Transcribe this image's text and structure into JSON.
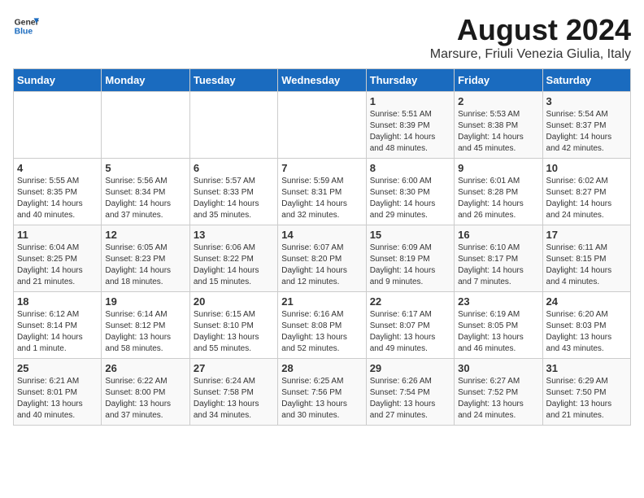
{
  "logo": {
    "text_general": "General",
    "text_blue": "Blue"
  },
  "title": "August 2024",
  "subtitle": "Marsure, Friuli Venezia Giulia, Italy",
  "headers": [
    "Sunday",
    "Monday",
    "Tuesday",
    "Wednesday",
    "Thursday",
    "Friday",
    "Saturday"
  ],
  "weeks": [
    [
      {
        "day": "",
        "info": ""
      },
      {
        "day": "",
        "info": ""
      },
      {
        "day": "",
        "info": ""
      },
      {
        "day": "",
        "info": ""
      },
      {
        "day": "1",
        "info": "Sunrise: 5:51 AM\nSunset: 8:39 PM\nDaylight: 14 hours\nand 48 minutes."
      },
      {
        "day": "2",
        "info": "Sunrise: 5:53 AM\nSunset: 8:38 PM\nDaylight: 14 hours\nand 45 minutes."
      },
      {
        "day": "3",
        "info": "Sunrise: 5:54 AM\nSunset: 8:37 PM\nDaylight: 14 hours\nand 42 minutes."
      }
    ],
    [
      {
        "day": "4",
        "info": "Sunrise: 5:55 AM\nSunset: 8:35 PM\nDaylight: 14 hours\nand 40 minutes."
      },
      {
        "day": "5",
        "info": "Sunrise: 5:56 AM\nSunset: 8:34 PM\nDaylight: 14 hours\nand 37 minutes."
      },
      {
        "day": "6",
        "info": "Sunrise: 5:57 AM\nSunset: 8:33 PM\nDaylight: 14 hours\nand 35 minutes."
      },
      {
        "day": "7",
        "info": "Sunrise: 5:59 AM\nSunset: 8:31 PM\nDaylight: 14 hours\nand 32 minutes."
      },
      {
        "day": "8",
        "info": "Sunrise: 6:00 AM\nSunset: 8:30 PM\nDaylight: 14 hours\nand 29 minutes."
      },
      {
        "day": "9",
        "info": "Sunrise: 6:01 AM\nSunset: 8:28 PM\nDaylight: 14 hours\nand 26 minutes."
      },
      {
        "day": "10",
        "info": "Sunrise: 6:02 AM\nSunset: 8:27 PM\nDaylight: 14 hours\nand 24 minutes."
      }
    ],
    [
      {
        "day": "11",
        "info": "Sunrise: 6:04 AM\nSunset: 8:25 PM\nDaylight: 14 hours\nand 21 minutes."
      },
      {
        "day": "12",
        "info": "Sunrise: 6:05 AM\nSunset: 8:23 PM\nDaylight: 14 hours\nand 18 minutes."
      },
      {
        "day": "13",
        "info": "Sunrise: 6:06 AM\nSunset: 8:22 PM\nDaylight: 14 hours\nand 15 minutes."
      },
      {
        "day": "14",
        "info": "Sunrise: 6:07 AM\nSunset: 8:20 PM\nDaylight: 14 hours\nand 12 minutes."
      },
      {
        "day": "15",
        "info": "Sunrise: 6:09 AM\nSunset: 8:19 PM\nDaylight: 14 hours\nand 9 minutes."
      },
      {
        "day": "16",
        "info": "Sunrise: 6:10 AM\nSunset: 8:17 PM\nDaylight: 14 hours\nand 7 minutes."
      },
      {
        "day": "17",
        "info": "Sunrise: 6:11 AM\nSunset: 8:15 PM\nDaylight: 14 hours\nand 4 minutes."
      }
    ],
    [
      {
        "day": "18",
        "info": "Sunrise: 6:12 AM\nSunset: 8:14 PM\nDaylight: 14 hours\nand 1 minute."
      },
      {
        "day": "19",
        "info": "Sunrise: 6:14 AM\nSunset: 8:12 PM\nDaylight: 13 hours\nand 58 minutes."
      },
      {
        "day": "20",
        "info": "Sunrise: 6:15 AM\nSunset: 8:10 PM\nDaylight: 13 hours\nand 55 minutes."
      },
      {
        "day": "21",
        "info": "Sunrise: 6:16 AM\nSunset: 8:08 PM\nDaylight: 13 hours\nand 52 minutes."
      },
      {
        "day": "22",
        "info": "Sunrise: 6:17 AM\nSunset: 8:07 PM\nDaylight: 13 hours\nand 49 minutes."
      },
      {
        "day": "23",
        "info": "Sunrise: 6:19 AM\nSunset: 8:05 PM\nDaylight: 13 hours\nand 46 minutes."
      },
      {
        "day": "24",
        "info": "Sunrise: 6:20 AM\nSunset: 8:03 PM\nDaylight: 13 hours\nand 43 minutes."
      }
    ],
    [
      {
        "day": "25",
        "info": "Sunrise: 6:21 AM\nSunset: 8:01 PM\nDaylight: 13 hours\nand 40 minutes."
      },
      {
        "day": "26",
        "info": "Sunrise: 6:22 AM\nSunset: 8:00 PM\nDaylight: 13 hours\nand 37 minutes."
      },
      {
        "day": "27",
        "info": "Sunrise: 6:24 AM\nSunset: 7:58 PM\nDaylight: 13 hours\nand 34 minutes."
      },
      {
        "day": "28",
        "info": "Sunrise: 6:25 AM\nSunset: 7:56 PM\nDaylight: 13 hours\nand 30 minutes."
      },
      {
        "day": "29",
        "info": "Sunrise: 6:26 AM\nSunset: 7:54 PM\nDaylight: 13 hours\nand 27 minutes."
      },
      {
        "day": "30",
        "info": "Sunrise: 6:27 AM\nSunset: 7:52 PM\nDaylight: 13 hours\nand 24 minutes."
      },
      {
        "day": "31",
        "info": "Sunrise: 6:29 AM\nSunset: 7:50 PM\nDaylight: 13 hours\nand 21 minutes."
      }
    ]
  ]
}
